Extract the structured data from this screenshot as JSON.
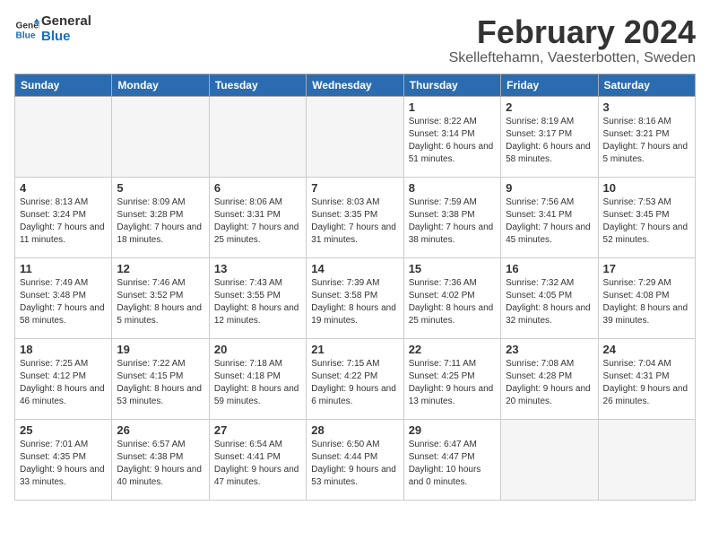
{
  "header": {
    "logo_line1": "General",
    "logo_line2": "Blue",
    "month": "February 2024",
    "location": "Skelleftehamn, Vaesterbotten, Sweden"
  },
  "weekdays": [
    "Sunday",
    "Monday",
    "Tuesday",
    "Wednesday",
    "Thursday",
    "Friday",
    "Saturday"
  ],
  "weeks": [
    [
      {
        "day": "",
        "empty": true
      },
      {
        "day": "",
        "empty": true
      },
      {
        "day": "",
        "empty": true
      },
      {
        "day": "",
        "empty": true
      },
      {
        "day": "1",
        "sunrise": "8:22 AM",
        "sunset": "3:14 PM",
        "daylight": "6 hours and 51 minutes."
      },
      {
        "day": "2",
        "sunrise": "8:19 AM",
        "sunset": "3:17 PM",
        "daylight": "6 hours and 58 minutes."
      },
      {
        "day": "3",
        "sunrise": "8:16 AM",
        "sunset": "3:21 PM",
        "daylight": "7 hours and 5 minutes."
      }
    ],
    [
      {
        "day": "4",
        "sunrise": "8:13 AM",
        "sunset": "3:24 PM",
        "daylight": "7 hours and 11 minutes."
      },
      {
        "day": "5",
        "sunrise": "8:09 AM",
        "sunset": "3:28 PM",
        "daylight": "7 hours and 18 minutes."
      },
      {
        "day": "6",
        "sunrise": "8:06 AM",
        "sunset": "3:31 PM",
        "daylight": "7 hours and 25 minutes."
      },
      {
        "day": "7",
        "sunrise": "8:03 AM",
        "sunset": "3:35 PM",
        "daylight": "7 hours and 31 minutes."
      },
      {
        "day": "8",
        "sunrise": "7:59 AM",
        "sunset": "3:38 PM",
        "daylight": "7 hours and 38 minutes."
      },
      {
        "day": "9",
        "sunrise": "7:56 AM",
        "sunset": "3:41 PM",
        "daylight": "7 hours and 45 minutes."
      },
      {
        "day": "10",
        "sunrise": "7:53 AM",
        "sunset": "3:45 PM",
        "daylight": "7 hours and 52 minutes."
      }
    ],
    [
      {
        "day": "11",
        "sunrise": "7:49 AM",
        "sunset": "3:48 PM",
        "daylight": "7 hours and 58 minutes."
      },
      {
        "day": "12",
        "sunrise": "7:46 AM",
        "sunset": "3:52 PM",
        "daylight": "8 hours and 5 minutes."
      },
      {
        "day": "13",
        "sunrise": "7:43 AM",
        "sunset": "3:55 PM",
        "daylight": "8 hours and 12 minutes."
      },
      {
        "day": "14",
        "sunrise": "7:39 AM",
        "sunset": "3:58 PM",
        "daylight": "8 hours and 19 minutes."
      },
      {
        "day": "15",
        "sunrise": "7:36 AM",
        "sunset": "4:02 PM",
        "daylight": "8 hours and 25 minutes."
      },
      {
        "day": "16",
        "sunrise": "7:32 AM",
        "sunset": "4:05 PM",
        "daylight": "8 hours and 32 minutes."
      },
      {
        "day": "17",
        "sunrise": "7:29 AM",
        "sunset": "4:08 PM",
        "daylight": "8 hours and 39 minutes."
      }
    ],
    [
      {
        "day": "18",
        "sunrise": "7:25 AM",
        "sunset": "4:12 PM",
        "daylight": "8 hours and 46 minutes."
      },
      {
        "day": "19",
        "sunrise": "7:22 AM",
        "sunset": "4:15 PM",
        "daylight": "8 hours and 53 minutes."
      },
      {
        "day": "20",
        "sunrise": "7:18 AM",
        "sunset": "4:18 PM",
        "daylight": "8 hours and 59 minutes."
      },
      {
        "day": "21",
        "sunrise": "7:15 AM",
        "sunset": "4:22 PM",
        "daylight": "9 hours and 6 minutes."
      },
      {
        "day": "22",
        "sunrise": "7:11 AM",
        "sunset": "4:25 PM",
        "daylight": "9 hours and 13 minutes."
      },
      {
        "day": "23",
        "sunrise": "7:08 AM",
        "sunset": "4:28 PM",
        "daylight": "9 hours and 20 minutes."
      },
      {
        "day": "24",
        "sunrise": "7:04 AM",
        "sunset": "4:31 PM",
        "daylight": "9 hours and 26 minutes."
      }
    ],
    [
      {
        "day": "25",
        "sunrise": "7:01 AM",
        "sunset": "4:35 PM",
        "daylight": "9 hours and 33 minutes."
      },
      {
        "day": "26",
        "sunrise": "6:57 AM",
        "sunset": "4:38 PM",
        "daylight": "9 hours and 40 minutes."
      },
      {
        "day": "27",
        "sunrise": "6:54 AM",
        "sunset": "4:41 PM",
        "daylight": "9 hours and 47 minutes."
      },
      {
        "day": "28",
        "sunrise": "6:50 AM",
        "sunset": "4:44 PM",
        "daylight": "9 hours and 53 minutes."
      },
      {
        "day": "29",
        "sunrise": "6:47 AM",
        "sunset": "4:47 PM",
        "daylight": "10 hours and 0 minutes."
      },
      {
        "day": "",
        "empty": true
      },
      {
        "day": "",
        "empty": true
      }
    ]
  ]
}
